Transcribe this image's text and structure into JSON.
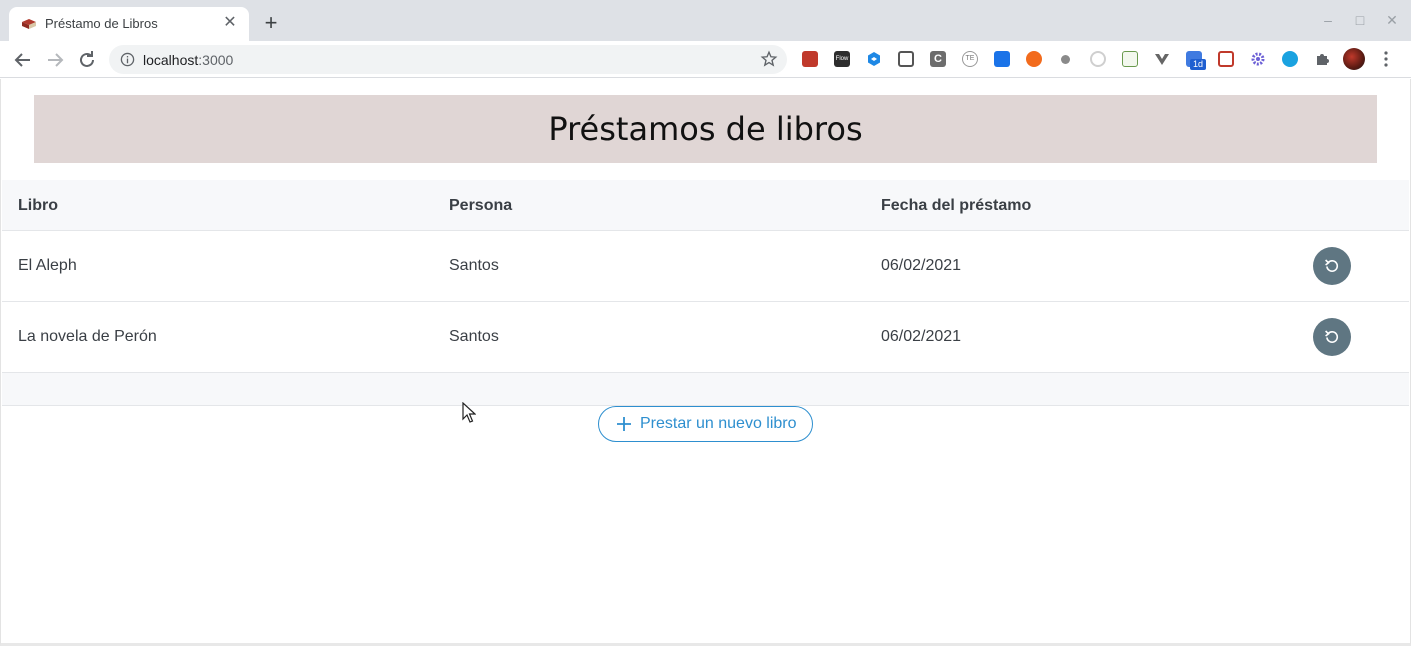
{
  "browser": {
    "tab_title": "Préstamo de Libros",
    "url_host": "localhost",
    "url_port": ":3000",
    "extensions": [
      "ext-red-icon",
      "ext-flow-icon",
      "ext-blue-hex-icon",
      "ext-grid-icon",
      "ext-c-icon",
      "ext-te-icon",
      "ext-blue-square-icon",
      "ext-orange-icon",
      "ext-gray-dot-icon",
      "ext-circle-icon",
      "ext-sheet-icon",
      "ext-v-icon",
      "ext-1d-icon",
      "ext-red-play-icon",
      "ext-gear-icon",
      "ext-a-icon",
      "puzzle-icon"
    ],
    "ext_badge": "1d",
    "ext_flow_label": "Flow",
    "ext_c_label": "C",
    "ext_te_label": "TE"
  },
  "page": {
    "title": "Préstamos de libros",
    "columns": [
      "Libro",
      "Persona",
      "Fecha del préstamo"
    ],
    "rows": [
      {
        "libro": "El Aleph",
        "persona": "Santos",
        "fecha": "06/02/2021"
      },
      {
        "libro": "La novela de Perón",
        "persona": "Santos",
        "fecha": "06/02/2021"
      }
    ],
    "new_loan_label": "Prestar un nuevo libro"
  },
  "colors": {
    "banner": "#e0d6d5",
    "accent": "#2e8fcf",
    "return_button": "#5f7682"
  }
}
